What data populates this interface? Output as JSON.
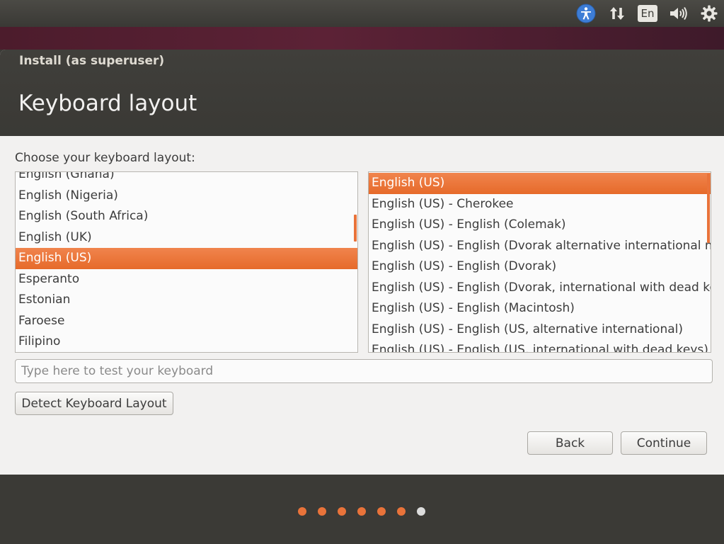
{
  "window": {
    "title": "Install (as superuser)",
    "page_title": "Keyboard layout"
  },
  "tray": {
    "icons": [
      "accessibility-icon",
      "network-arrows-icon",
      "keyboard-indicator",
      "volume-icon",
      "settings-gear-icon"
    ],
    "keyboard_indicator": "En"
  },
  "main": {
    "prompt": "Choose your keyboard layout:",
    "layouts": [
      {
        "label": "English (Ghana)",
        "selected": false
      },
      {
        "label": "English (Nigeria)",
        "selected": false
      },
      {
        "label": "English (South Africa)",
        "selected": false
      },
      {
        "label": "English (UK)",
        "selected": false
      },
      {
        "label": "English (US)",
        "selected": true
      },
      {
        "label": "Esperanto",
        "selected": false
      },
      {
        "label": "Estonian",
        "selected": false
      },
      {
        "label": "Faroese",
        "selected": false
      },
      {
        "label": "Filipino",
        "selected": false
      }
    ],
    "variants": [
      {
        "label": "English (US)",
        "selected": true
      },
      {
        "label": "English (US) - Cherokee",
        "selected": false
      },
      {
        "label": "English (US) - English (Colemak)",
        "selected": false
      },
      {
        "label": "English (US) - English (Dvorak alternative international no",
        "selected": false
      },
      {
        "label": "English (US) - English (Dvorak)",
        "selected": false
      },
      {
        "label": "English (US) - English (Dvorak, international with dead ke",
        "selected": false
      },
      {
        "label": "English (US) - English (Macintosh)",
        "selected": false
      },
      {
        "label": "English (US) - English (US, alternative international)",
        "selected": false
      },
      {
        "label": "English (US) - English (US, international with dead keys)",
        "selected": false
      }
    ],
    "test_placeholder": "Type here to test your keyboard",
    "test_value": "",
    "detect_button": "Detect Keyboard Layout"
  },
  "footer": {
    "back_button": "Back",
    "continue_button": "Continue"
  },
  "progress": {
    "total_steps": 7,
    "current_step": 7
  },
  "colors": {
    "accent": "#e9733a",
    "header_bg": "#3c3b37",
    "window_bg": "#f2f1f0",
    "inactive_dot": "#dcdcdc"
  }
}
